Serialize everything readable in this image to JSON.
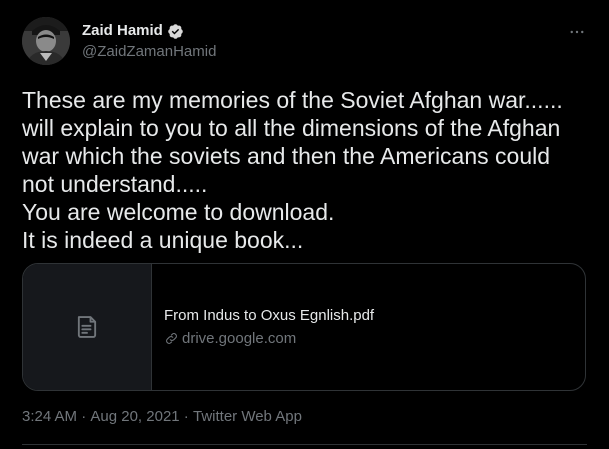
{
  "author": {
    "display_name": "Zaid Hamid",
    "handle": "@ZaidZamanHamid",
    "verified": true,
    "avatar_icon": "user-avatar"
  },
  "more_icon": "more-horizontal-icon",
  "tweet": {
    "text": "These are my memories of the Soviet Afghan war......\nwill explain to you to all the dimensions of the Afghan\nwar which the soviets and then the Americans could\nnot understand.....\nYou are welcome to download.\nIt is indeed a unique book..."
  },
  "card": {
    "icon": "document-icon",
    "title": "From Indus to Oxus Egnlish.pdf",
    "domain": "drive.google.com",
    "link_icon": "link-icon"
  },
  "meta": {
    "time": "3:24 AM",
    "separator1": " · ",
    "date": "Aug 20, 2021",
    "separator2": " · ",
    "source": "Twitter Web App"
  },
  "colors": {
    "background": "#000000",
    "text": "#e7e9ea",
    "secondary": "#71767b",
    "border": "#2f3336",
    "verified": "#d9d9d9"
  }
}
